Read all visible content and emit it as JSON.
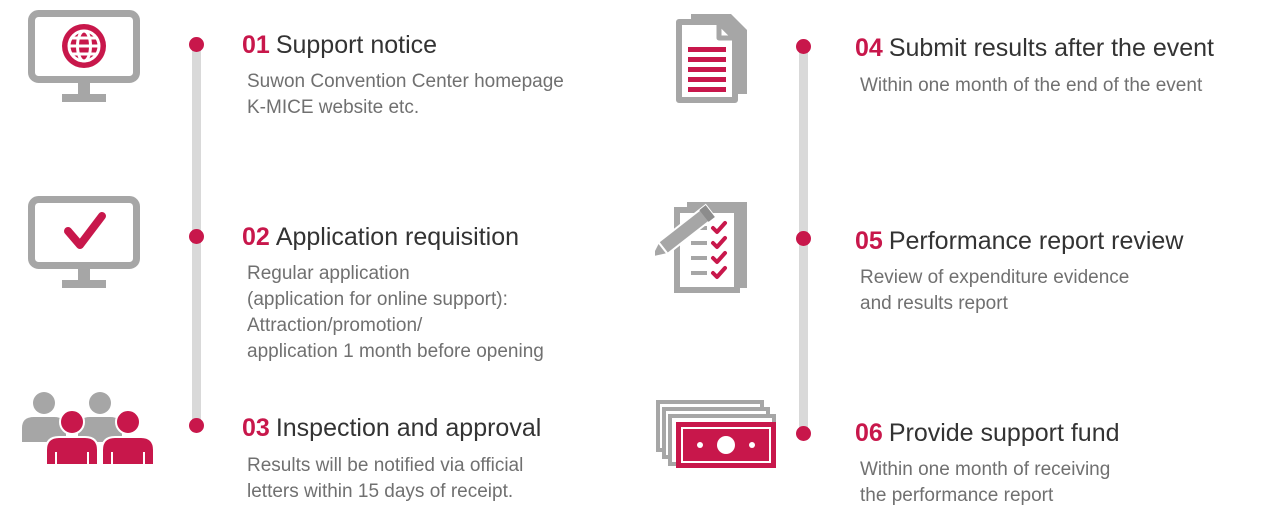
{
  "colors": {
    "accent": "#c8174b",
    "icon_gray": "#a6a6a6",
    "line_gray": "#d9d9d9"
  },
  "steps": [
    {
      "num": "01",
      "title": "Support notice",
      "icon": "monitor-globe-icon",
      "desc": [
        "Suwon Convention Center homepage",
        "K-MICE website etc."
      ]
    },
    {
      "num": "02",
      "title": "Application requisition",
      "icon": "monitor-check-icon",
      "desc": [
        "Regular application",
        "(application for online support):",
        "Attraction/promotion/",
        "application 1 month before opening"
      ]
    },
    {
      "num": "03",
      "title": "Inspection and approval",
      "icon": "people-group-icon",
      "desc": [
        "Results will be notified via official",
        "letters within 15 days of receipt."
      ]
    },
    {
      "num": "04",
      "title": "Submit results after the event",
      "icon": "document-stack-icon",
      "desc": [
        "Within one month of the end of the event"
      ]
    },
    {
      "num": "05",
      "title": "Performance report review",
      "icon": "checklist-pen-icon",
      "desc": [
        "Review of expenditure evidence",
        "and results report"
      ]
    },
    {
      "num": "06",
      "title": "Provide support fund",
      "icon": "money-bills-icon",
      "desc": [
        "Within one month of receiving",
        "the performance report"
      ]
    }
  ]
}
